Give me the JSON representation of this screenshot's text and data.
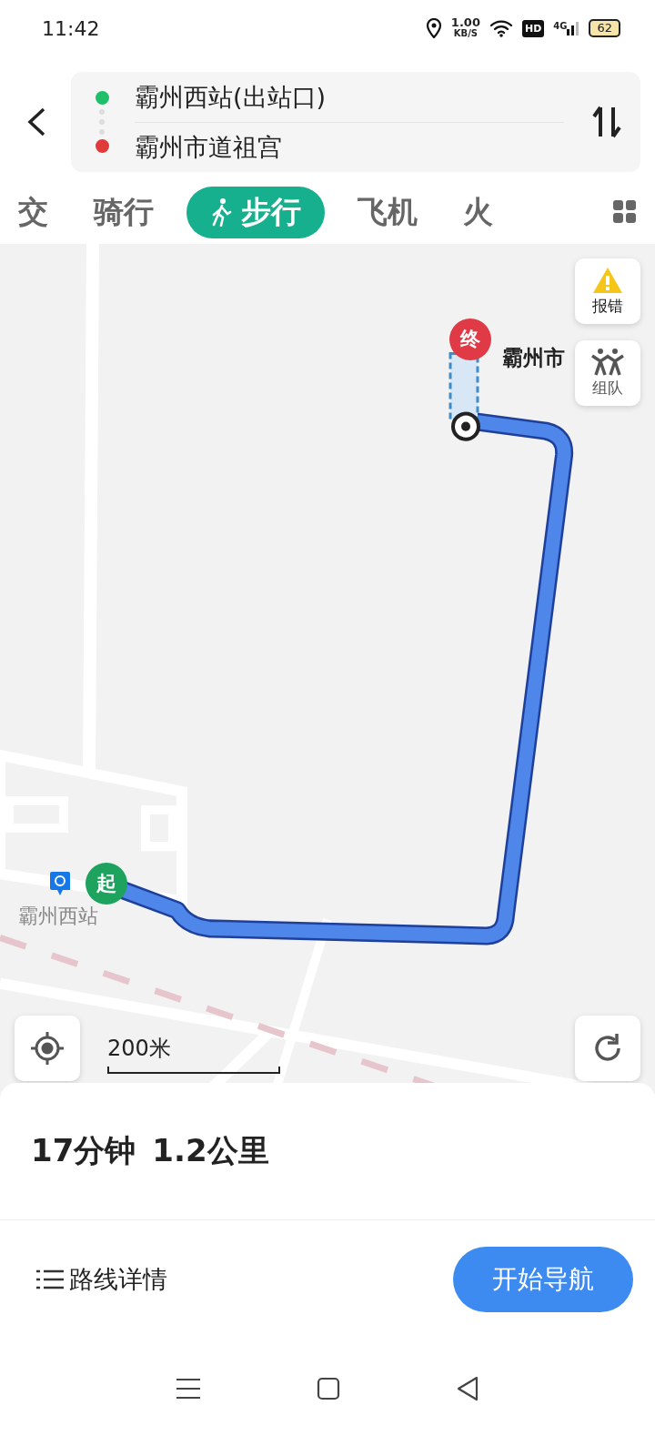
{
  "status_bar": {
    "time": "11:42",
    "net_speed": "1.00",
    "net_unit": "KB/S",
    "hd": "HD",
    "network": "4G",
    "battery": "62"
  },
  "route": {
    "from": "霸州西站(出站口)",
    "to": "霸州市道祖宫"
  },
  "tabs": [
    {
      "label": "交",
      "selected": false
    },
    {
      "label": "骑行",
      "selected": false
    },
    {
      "label": "步行",
      "selected": true
    },
    {
      "label": "飞机",
      "selected": false
    },
    {
      "label": "火",
      "selected": false
    }
  ],
  "map": {
    "report_button": "报错",
    "team_button": "组队",
    "end_pin": "终",
    "destination_label": "霸州市",
    "start_pin": "起",
    "station_label": "霸州西站",
    "scale": "200米"
  },
  "summary": {
    "duration": "17分钟",
    "distance": "1.2公里"
  },
  "actions": {
    "details": "路线详情",
    "start": "开始导航"
  }
}
